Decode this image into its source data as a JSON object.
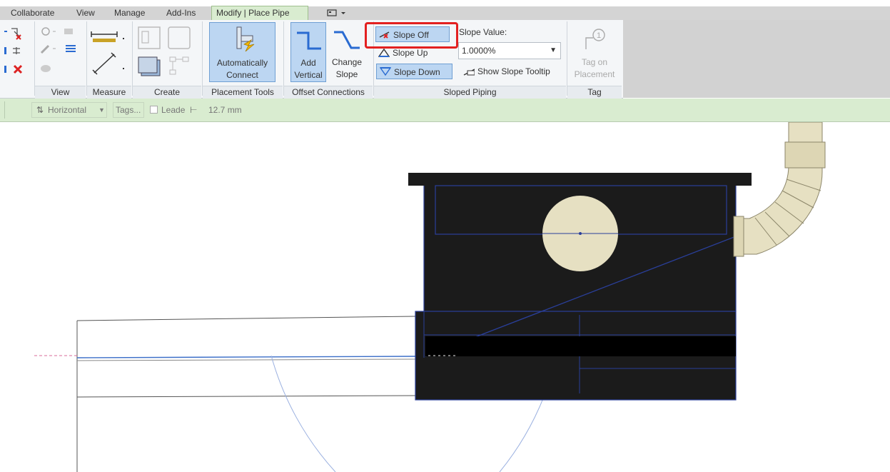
{
  "tabs": [
    {
      "label": "Collaborate"
    },
    {
      "label": "View"
    },
    {
      "label": "Manage"
    },
    {
      "label": "Add-Ins"
    },
    {
      "label": "Modify | Place Pipe"
    }
  ],
  "panels": {
    "view": "View",
    "measure": "Measure",
    "create": "Create",
    "placement_tools": "Placement Tools",
    "offset_connections": "Offset Connections",
    "sloped_piping": "Sloped Piping",
    "tag": "Tag"
  },
  "buttons": {
    "automatically_connect": [
      "Automatically",
      "Connect"
    ],
    "add_vertical": [
      "Add",
      "Vertical"
    ],
    "change_slope": [
      "Change",
      "Slope"
    ],
    "slope_off": "Slope Off",
    "slope_up": "Slope Up",
    "slope_down": "Slope Down",
    "slope_value_label": "Slope Value:",
    "slope_value": "1.0000%",
    "show_slope_tooltip": "Show Slope Tooltip",
    "tag_on_placement": [
      "Tag on",
      "Placement"
    ]
  },
  "options_bar": {
    "orientation": "Horizontal",
    "tags": "Tags...",
    "leader": "Leade",
    "length": "12.7 mm"
  },
  "colors": {
    "active_tab": "#d9ecd0",
    "pressed_button": "#bcd6f2",
    "highlight": "#e32020",
    "equipment_body": "#1b1b1b",
    "equipment_edge": "#2a3f9a",
    "pipe_cream": "#e6e0c2"
  },
  "icons": {
    "slope_off": "slope-off-icon",
    "slope_up": "slope-up-icon",
    "slope_down": "slope-down-icon",
    "tooltip": "slope-tooltip-icon",
    "tag": "tag-icon"
  }
}
